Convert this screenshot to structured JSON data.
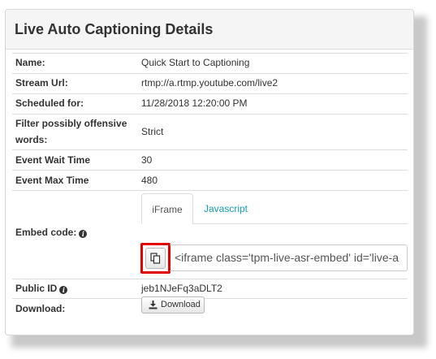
{
  "panel": {
    "title": "Live Auto Captioning Details"
  },
  "rows": {
    "name": {
      "label": "Name:",
      "value": "Quick Start to Captioning"
    },
    "stream_url": {
      "label": "Stream Url:",
      "value": "rtmp://a.rtmp.youtube.com/live2"
    },
    "scheduled": {
      "label": "Scheduled for:",
      "value": "11/28/2018 12:20:00 PM"
    },
    "filter": {
      "label_line1": "Filter possibly offensive",
      "label_line2": "words:",
      "value": "Strict"
    },
    "wait_time": {
      "label": "Event Wait Time",
      "value": "30"
    },
    "max_time": {
      "label": "Event Max Time",
      "value": "480"
    },
    "embed": {
      "label": "Embed code:",
      "info_icon": "info-circle-icon",
      "tabs": [
        {
          "label": "iFrame",
          "active": true
        },
        {
          "label": "Javascript",
          "active": false
        }
      ],
      "code": "<iframe class='tpm-live-asr-embed' id='live-a",
      "copy_icon": "clipboard-copy-icon"
    },
    "public_id": {
      "label": "Public ID",
      "info_icon": "info-circle-icon",
      "value": "jeb1NJeFq3aDLT2"
    },
    "download": {
      "label": "Download:",
      "button_label": "Download",
      "button_icon": "download-icon"
    }
  },
  "colors": {
    "tab_link": "#1a9bb0",
    "highlight_border": "#e00000",
    "header_bg": "#f5f5f5"
  }
}
